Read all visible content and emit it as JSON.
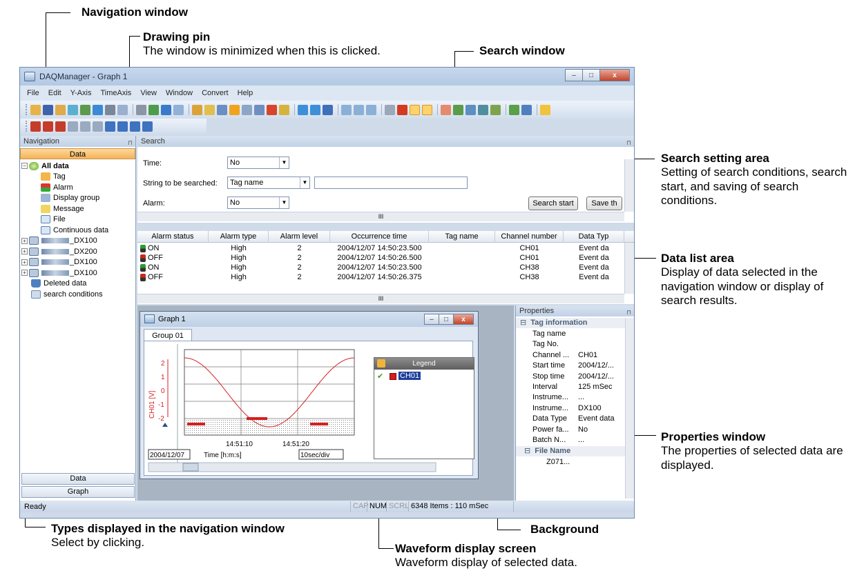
{
  "annotations": {
    "navigation_window": {
      "title": "Navigation window"
    },
    "drawing_pin": {
      "title": "Drawing pin",
      "desc": "The window is minimized when this is clicked."
    },
    "search_window": {
      "title": "Search window"
    },
    "search_setting_area": {
      "title": "Search setting area",
      "desc": "Setting of search conditions, search start, and saving of search conditions."
    },
    "data_list_area": {
      "title": "Data list area",
      "desc": "Display of data selected in the navigation window or display of search results."
    },
    "properties_window": {
      "title": "Properties window",
      "desc": "The properties of selected data are displayed."
    },
    "types_displayed": {
      "title": "Types displayed in the navigation window",
      "desc": "Select by clicking."
    },
    "background": {
      "title": "Background"
    },
    "waveform_display": {
      "title": "Waveform display screen",
      "desc": "Waveform display of selected data."
    }
  },
  "app": {
    "title": "DAQManager - Graph 1",
    "menu": [
      "File",
      "Edit",
      "Y-Axis",
      "TimeAxis",
      "View",
      "Window",
      "Convert",
      "Help"
    ],
    "window_controls": {
      "minimize": "–",
      "maximize": "□",
      "close": "x"
    }
  },
  "navigation": {
    "header": "Navigation",
    "tab_label": "Data",
    "tree": {
      "all_data": "All data",
      "tag": "Tag",
      "alarm": "Alarm",
      "display_group": "Display group",
      "message": "Message",
      "file": "File",
      "continuous_data": "Continuous data",
      "devices": [
        "_DX100",
        "_DX200",
        "_DX100",
        "_DX100"
      ],
      "deleted_data": "Deleted data",
      "search_conditions": "search conditions"
    },
    "bottom_tabs": [
      "Data",
      "Graph"
    ]
  },
  "search": {
    "header": "Search",
    "time_label": "Time:",
    "time_value": "No",
    "string_label": "String to be searched:",
    "string_value": "Tag name",
    "string_input": "",
    "alarm_label": "Alarm:",
    "alarm_value": "No",
    "start_button": "Search start",
    "save_button": "Save th",
    "scroll_mark": "III"
  },
  "data_list": {
    "columns": [
      "Alarm status",
      "Alarm type",
      "Alarm level",
      "Occurrence time",
      "Tag name",
      "Channel number",
      "Data Typ"
    ],
    "rows": [
      {
        "status": "ON",
        "type": "High",
        "level": "2",
        "time": "2004/12/07 14:50:23.500",
        "tag": "",
        "channel": "CH01",
        "data_type": "Event da",
        "color": "#2e9b2e"
      },
      {
        "status": "OFF",
        "type": "High",
        "level": "2",
        "time": "2004/12/07 14:50:26.500",
        "tag": "",
        "channel": "CH01",
        "data_type": "Event da",
        "color": "#cc2a1a"
      },
      {
        "status": "ON",
        "type": "High",
        "level": "2",
        "time": "2004/12/07 14:50:23.500",
        "tag": "",
        "channel": "CH38",
        "data_type": "Event da",
        "color": "#2e9b2e"
      },
      {
        "status": "OFF",
        "type": "High",
        "level": "2",
        "time": "2004/12/07 14:50:26.375",
        "tag": "",
        "channel": "CH38",
        "data_type": "Event da",
        "color": "#cc2a1a"
      }
    ],
    "scroll_mark": "III"
  },
  "graph_window": {
    "title": "Graph 1",
    "tab": "Group 01",
    "y_axis_label": "CH01 [V]",
    "y_ticks": [
      "2",
      "1",
      "0",
      "-1",
      "-2"
    ],
    "x_ticks": [
      "14:51:10",
      "14:51:20"
    ],
    "date": "2004/12/07",
    "time_axis_label": "Time [h:m:s]",
    "scale": "10sec/div",
    "legend_title": "Legend",
    "legend_entry": "CH01",
    "wave_color": "#d42020"
  },
  "properties": {
    "header": "Properties",
    "category_tag": "Tag information",
    "rows": [
      {
        "k": "Tag name",
        "v": ""
      },
      {
        "k": "Tag No.",
        "v": ""
      },
      {
        "k": "Channel ...",
        "v": "CH01"
      },
      {
        "k": "Start time",
        "v": "2004/12/..."
      },
      {
        "k": "Stop time",
        "v": "2004/12/..."
      },
      {
        "k": "Interval",
        "v": "125 mSec"
      },
      {
        "k": "Instrume...",
        "v": "..."
      },
      {
        "k": "Instrume...",
        "v": "DX100"
      },
      {
        "k": "Data Type",
        "v": "Event data"
      },
      {
        "k": "Power fa...",
        "v": "No"
      },
      {
        "k": "Batch N...",
        "v": "..."
      }
    ],
    "category_file": "File Name",
    "file_value": "Z071..."
  },
  "status_bar": {
    "text": "Ready",
    "cap": "CAP",
    "num": "NUM",
    "scrl": "SCRL",
    "items": "6348 Items : 110 mSec"
  }
}
